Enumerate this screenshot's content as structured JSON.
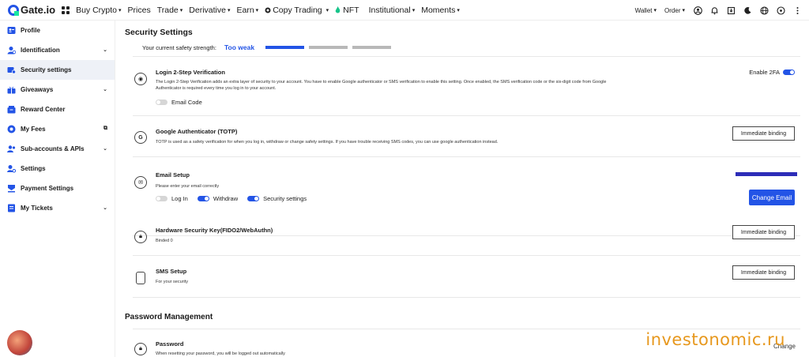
{
  "nav": {
    "brand": "Gate.io",
    "items": [
      {
        "label": "Buy Crypto",
        "caret": "▾"
      },
      {
        "label": "Prices",
        "caret": ""
      },
      {
        "label": "Trade",
        "caret": "▾"
      },
      {
        "label": "Derivative",
        "caret": "▾"
      },
      {
        "label": "Earn",
        "caret": "▾"
      },
      {
        "label": "Copy Trading",
        "caret": "▾"
      },
      {
        "label": "NFT",
        "caret": ""
      },
      {
        "label": "Institutional",
        "caret": "▾"
      },
      {
        "label": "Moments",
        "caret": "▾"
      }
    ],
    "wallet": "Wallet",
    "order": "Order",
    "caret": "▾"
  },
  "sidebar": {
    "items": [
      {
        "label": "Profile"
      },
      {
        "label": "Identification",
        "chev": "⌄"
      },
      {
        "label": "Security settings"
      },
      {
        "label": "Giveaways",
        "chev": "⌄"
      },
      {
        "label": "Reward Center"
      },
      {
        "label": "My Fees",
        "ext": "⧉"
      },
      {
        "label": "Sub-accounts & APIs",
        "chev": "⌄"
      },
      {
        "label": "Settings"
      },
      {
        "label": "Payment Settings"
      },
      {
        "label": "My Tickets",
        "chev": "⌄"
      }
    ]
  },
  "main": {
    "title": "Security Settings",
    "strength_label": "Your current safety strength:",
    "strength_value": "Too weak",
    "strength_level": 1,
    "strength_total": 3,
    "login2fa": {
      "title": "Login 2-Step Verification",
      "desc": "The Login 2-Step Verification adds an extra layer of security to your account. You have to enable Google authenticator or SMS verification to enable this setting. Once enabled, the SMS verification code or the six-digit code from Google Authenticator is required every time you log in to your account.",
      "enable_label": "Enable 2FA",
      "email_code_label": "Email Code"
    },
    "google": {
      "title": "Google Authenticator (TOTP)",
      "desc": "TOTP is used as a safety verification for when you log in, withdraw or change safety settings. If you have trouble receiving SMS codes, you can use google authentication instead.",
      "button": "Immediate binding"
    },
    "email": {
      "title": "Email Setup",
      "desc": "Please enter your email correctly",
      "toggles": [
        "Log In",
        "Withdraw",
        "Security settings"
      ],
      "button": "Change Email"
    },
    "hardware": {
      "title": "Hardware Security Key(FIDO2/WebAuthn)",
      "desc": "Binded 0",
      "button": "Immediate binding"
    },
    "sms": {
      "title": "SMS Setup",
      "desc": "For your security",
      "button": "Immediate binding"
    },
    "password_section": "Password Management",
    "password": {
      "title": "Password",
      "desc": "When resetting your password, you will be logged out automatically",
      "link": "Change"
    }
  },
  "watermark": "investonomic.ru",
  "colors": {
    "accent": "#2354e6",
    "watermark": "#e7981e"
  }
}
